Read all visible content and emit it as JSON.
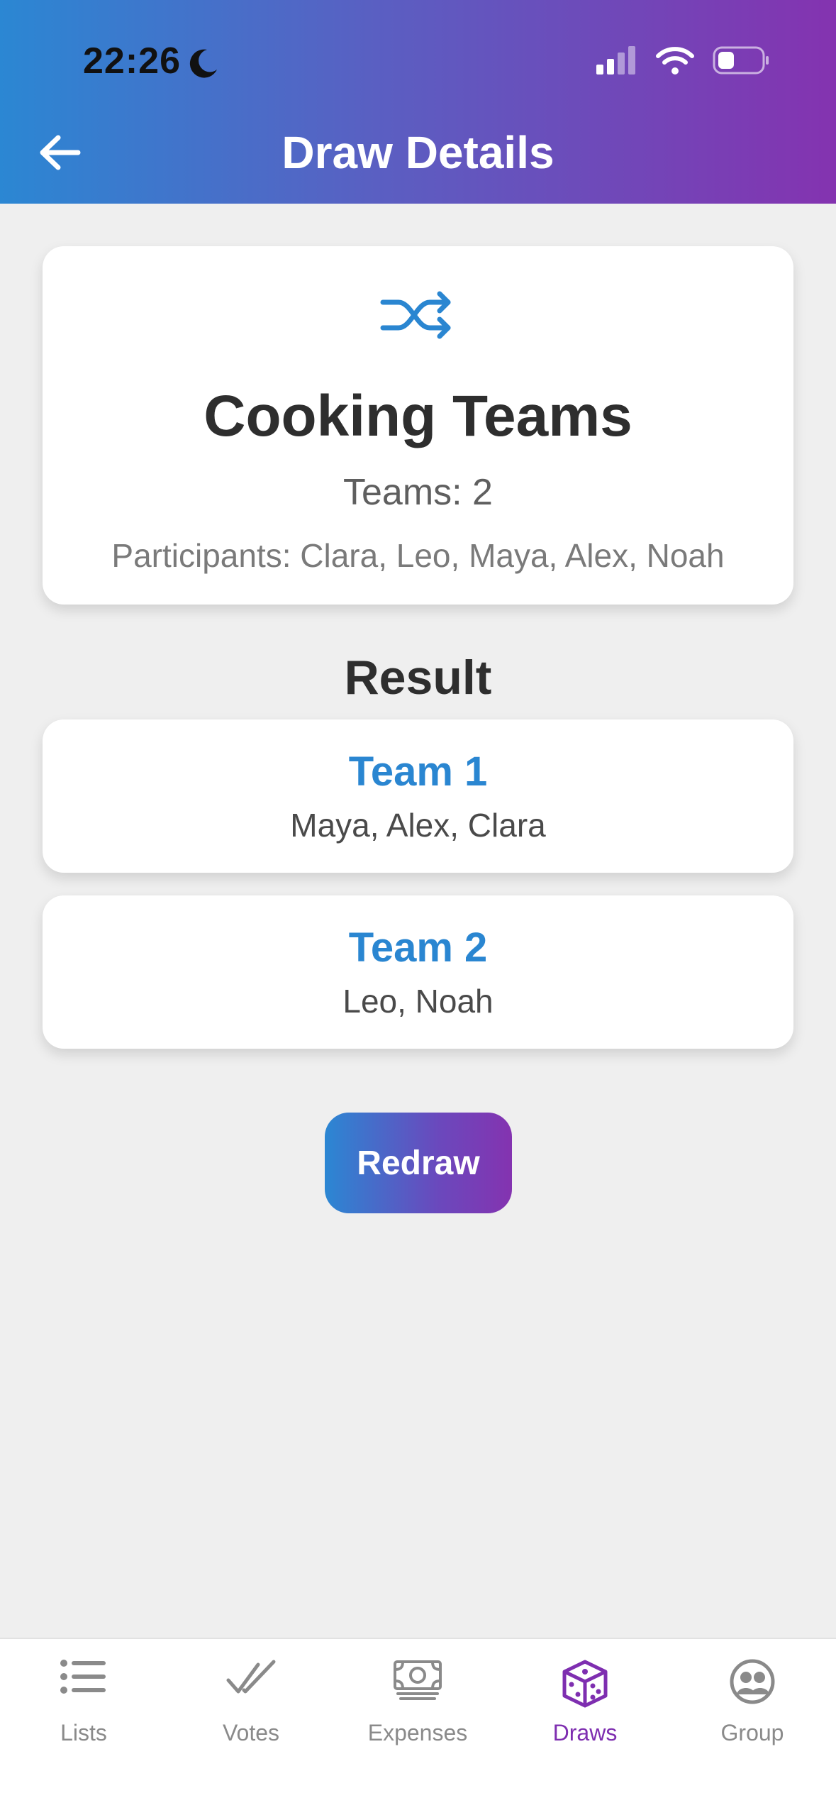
{
  "status_bar": {
    "time": "22:26"
  },
  "header": {
    "title": "Draw Details"
  },
  "draw": {
    "name": "Cooking Teams",
    "teams_label": "Teams: 2",
    "participants_label": "Participants: Clara, Leo, Maya, Alex, Noah"
  },
  "result": {
    "heading": "Result",
    "teams": [
      {
        "name": "Team 1",
        "members": "Maya, Alex, Clara"
      },
      {
        "name": "Team 2",
        "members": "Leo, Noah"
      }
    ]
  },
  "actions": {
    "redraw_label": "Redraw"
  },
  "tabbar": {
    "items": [
      {
        "label": "Lists",
        "icon": "list-icon",
        "active": false
      },
      {
        "label": "Votes",
        "icon": "double-check-icon",
        "active": false
      },
      {
        "label": "Expenses",
        "icon": "banknote-icon",
        "active": false
      },
      {
        "label": "Draws",
        "icon": "dice-cube-icon",
        "active": true
      },
      {
        "label": "Group",
        "icon": "group-icon",
        "active": false
      }
    ]
  },
  "colors": {
    "accent_blue": "#2b87d3",
    "accent_purple": "#8433b0",
    "active_tab": "#7e2eb0",
    "background": "#efefef"
  }
}
